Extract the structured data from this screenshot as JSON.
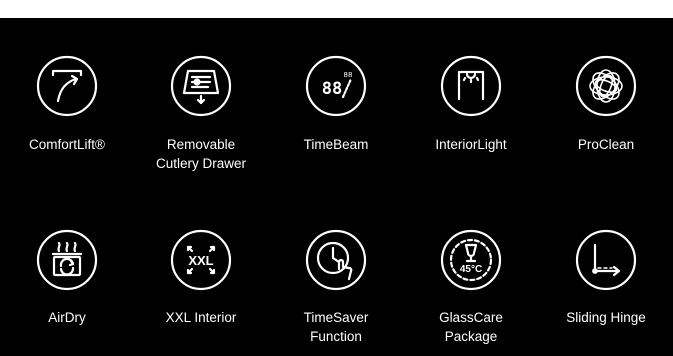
{
  "features": [
    {
      "label": "ComfortLift®",
      "icon": "comfortlift-icon"
    },
    {
      "label": "Removable\nCutlery Drawer",
      "icon": "cutlery-drawer-icon"
    },
    {
      "label": "TimeBeam",
      "icon": "timebeam-icon",
      "icon_text": "88",
      "icon_text_small": "88"
    },
    {
      "label": "InteriorLight",
      "icon": "interior-light-icon"
    },
    {
      "label": "ProClean",
      "icon": "proclean-icon"
    },
    {
      "label": "AirDry",
      "icon": "airdry-icon"
    },
    {
      "label": "XXL Interior",
      "icon": "xxl-interior-icon",
      "icon_text": "XXL"
    },
    {
      "label": "TimeSaver\nFunction",
      "icon": "timesaver-icon"
    },
    {
      "label": "GlassCare\nPackage",
      "icon": "glasscare-icon",
      "icon_text": "45°C"
    },
    {
      "label": "Sliding Hinge",
      "icon": "sliding-hinge-icon"
    }
  ],
  "colors": {
    "background": "#000000",
    "foreground": "#ffffff",
    "page": "#ffffff"
  }
}
